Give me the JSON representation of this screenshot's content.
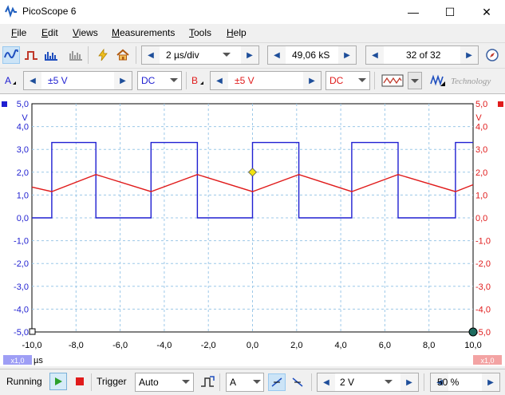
{
  "app": {
    "title": "PicoScope 6"
  },
  "window_controls": {
    "minimize": "—",
    "maximize": "☐",
    "close": "✕"
  },
  "menu": [
    {
      "key": "F",
      "rest": "ile"
    },
    {
      "key": "E",
      "rest": "dit"
    },
    {
      "key": "V",
      "rest": "iews"
    },
    {
      "key": "M",
      "rest": "easurements"
    },
    {
      "key": "T",
      "rest": "ools"
    },
    {
      "key": "H",
      "rest": "elp"
    }
  ],
  "toolbar1": {
    "timebase": "2 µs/div",
    "samples": "49,06 kS",
    "buffer": "32 of 32"
  },
  "toolbar2": {
    "channel_a": {
      "label": "A",
      "range": "±5 V",
      "coupling": "DC",
      "color": "#1f1fd1"
    },
    "channel_b": {
      "label": "B",
      "range": "±5 V",
      "coupling": "DC",
      "color": "#e01b1b"
    },
    "brand": "Technology"
  },
  "scope": {
    "left_unit": "V",
    "right_unit": "V",
    "x_unit": "µs",
    "left_scale": "x1,0",
    "right_scale": "x1,0"
  },
  "chart_data": {
    "type": "line",
    "xlim": [
      -10,
      10
    ],
    "ylim": [
      -5,
      5
    ],
    "x_ticks": [
      "-10,0",
      "-8,0",
      "-6,0",
      "-4,0",
      "-2,0",
      "0,0",
      "2,0",
      "4,0",
      "6,0",
      "8,0",
      "10,0"
    ],
    "y_ticks": [
      "5,0",
      "4,0",
      "3,0",
      "2,0",
      "1,0",
      "0,0",
      "-1,0",
      "-2,0",
      "-3,0",
      "-4,0",
      "-5,0"
    ],
    "grid": true,
    "series": [
      {
        "id": "A",
        "color": "#1f1fd1",
        "x": [
          -10,
          -9.1,
          -9.1,
          -7.1,
          -7.1,
          -4.6,
          -4.6,
          -2.5,
          -2.5,
          0,
          0,
          2.1,
          2.1,
          4.5,
          4.5,
          6.6,
          6.6,
          9.2,
          9.2,
          10
        ],
        "y": [
          0,
          0,
          3.3,
          3.3,
          0,
          0,
          3.3,
          3.3,
          0,
          0,
          3.3,
          3.3,
          0,
          0,
          3.3,
          3.3,
          0,
          0,
          3.3,
          3.3
        ]
      },
      {
        "id": "B",
        "color": "#e01b1b",
        "x": [
          -10,
          -9.1,
          -7.1,
          -4.6,
          -2.5,
          0,
          2.1,
          4.5,
          6.6,
          9.2,
          10
        ],
        "y": [
          1.35,
          1.15,
          1.9,
          1.15,
          1.9,
          1.15,
          1.9,
          1.15,
          1.9,
          1.15,
          1.45
        ]
      }
    ],
    "trigger": {
      "x": 0,
      "y": 2.0,
      "color": "#f2e311"
    }
  },
  "statusbar": {
    "running": "Running",
    "trigger_label": "Trigger",
    "trigger_mode": "Auto",
    "trigger_channel": "A",
    "threshold": "2 V",
    "pre_trigger": "50 %"
  }
}
